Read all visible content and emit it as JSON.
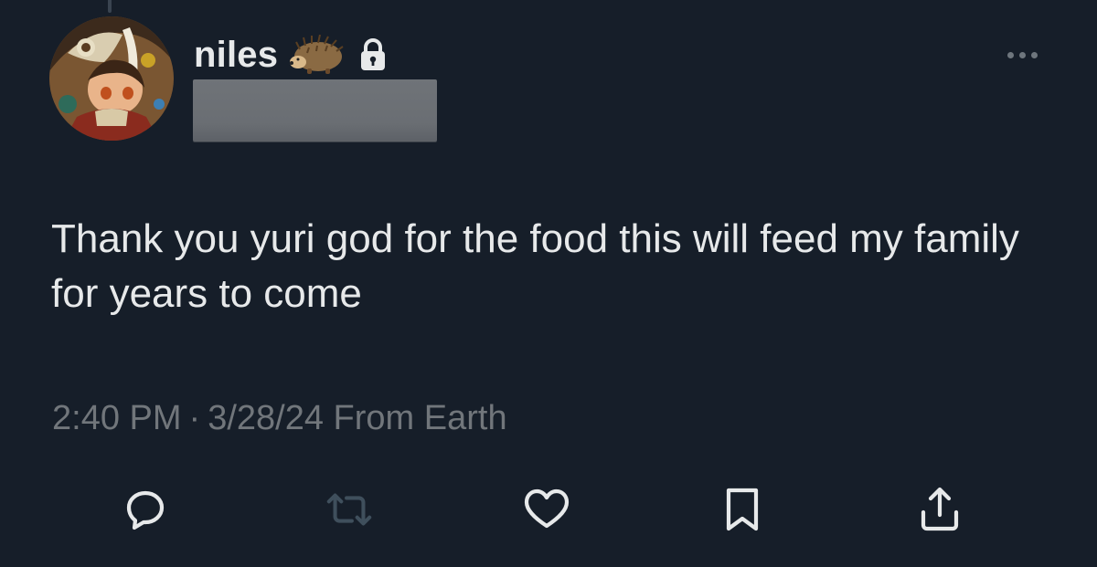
{
  "tweet": {
    "author": {
      "display_name": "niles",
      "name_emoji": "hedgehog-emoji",
      "protected_icon": "lock-icon",
      "handle": ""
    },
    "text": "Thank you yuri god for the food this will feed my family for years to come",
    "time": "2:40 PM",
    "separator": "·",
    "date": "3/28/24",
    "source": "From Earth"
  },
  "actions": [
    {
      "icon": "reply-icon"
    },
    {
      "icon": "retweet-icon"
    },
    {
      "icon": "like-icon"
    },
    {
      "icon": "bookmark-icon"
    },
    {
      "icon": "share-icon"
    }
  ],
  "colors": {
    "background": "#161e29",
    "text_primary": "#e7e9ea",
    "text_secondary": "#71767b",
    "retweet_disabled": "#3f4f5c",
    "redaction": "#6c7075"
  }
}
